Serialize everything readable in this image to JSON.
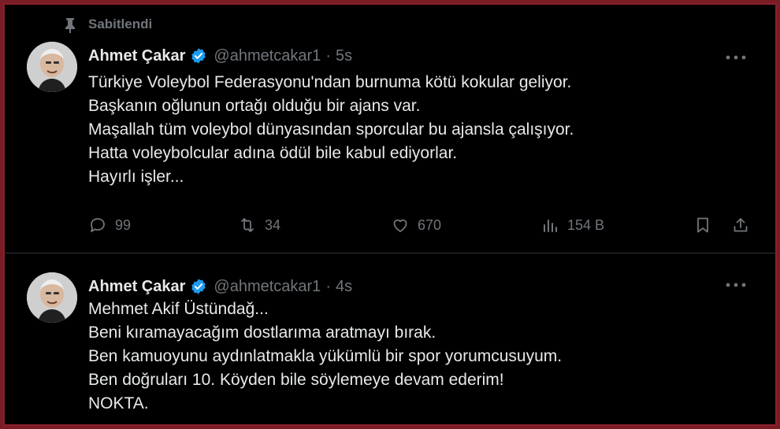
{
  "tweets": [
    {
      "pinned_label": "Sabitlendi",
      "name": "Ahmet Çakar",
      "handle": "@ahmetcakar1",
      "separator": "·",
      "time": "5s",
      "text": "Türkiye Voleybol Federasyonu'ndan burnuma kötü kokular geliyor.\nBaşkanın oğlunun ortağı olduğu bir ajans var.\nMaşallah tüm voleybol dünyasından sporcular bu ajansla çalışıyor.\nHatta voleybolcular adına ödül bile kabul ediyorlar.\nHayırlı işler...",
      "replies": "99",
      "retweets": "34",
      "likes": "670",
      "views": "154 B"
    },
    {
      "name": "Ahmet Çakar",
      "handle": "@ahmetcakar1",
      "separator": "·",
      "time": "4s",
      "text": "Mehmet Akif Üstündağ...\nBeni kıramayacağım dostlarıma aratmayı bırak.\nBen kamuoyunu aydınlatmakla yükümlü bir spor yorumcusuyum.\nBen doğruları 10. Köyden bile söylemeye devam ederim!\nNOKTA."
    }
  ],
  "icons": {
    "pin": "pin-icon",
    "verified": "verified-badge-icon",
    "more": "more-options-icon",
    "reply": "reply-icon",
    "retweet": "retweet-icon",
    "like": "heart-icon",
    "views": "views-chart-icon",
    "bookmark": "bookmark-icon",
    "share": "share-icon"
  },
  "colors": {
    "background": "#000000",
    "text": "#e7e9ea",
    "muted": "#71767b",
    "verified": "#1d9bf0",
    "frame": "#8a1f2a",
    "divider": "#2f3336"
  }
}
